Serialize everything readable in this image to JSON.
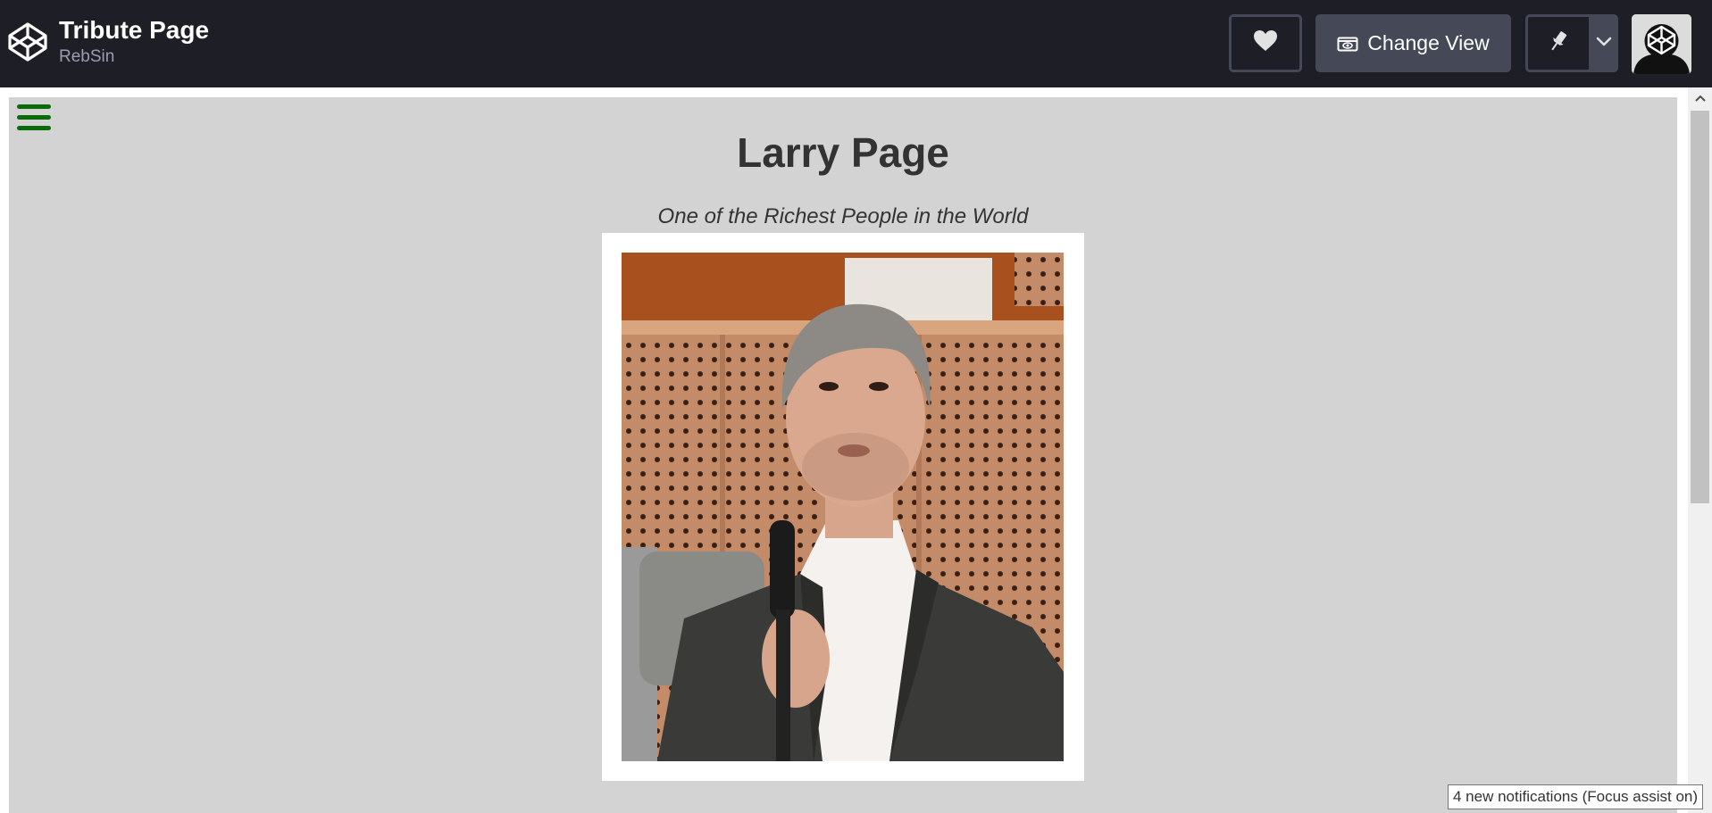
{
  "header": {
    "pen_title": "Tribute Page",
    "author": "RebSin",
    "change_view_label": "Change View"
  },
  "icons": {
    "logo": "codepen-logo-icon",
    "heart": "heart-icon",
    "view": "eye-icon",
    "pin": "pin-icon",
    "caret": "chevron-down-icon",
    "avatar": "avatar",
    "menu": "hamburger-menu-icon"
  },
  "page": {
    "heading": "Larry Page",
    "tagline": "One of the Richest People in the World",
    "image_alt": "Larry Page photo"
  },
  "notification": {
    "text": "4 new notifications (Focus assist on)"
  },
  "colors": {
    "topbar": "#1e1f26",
    "button": "#444857",
    "page_background": "#d3d3d3",
    "menu_icon": "#0a6b0a"
  }
}
